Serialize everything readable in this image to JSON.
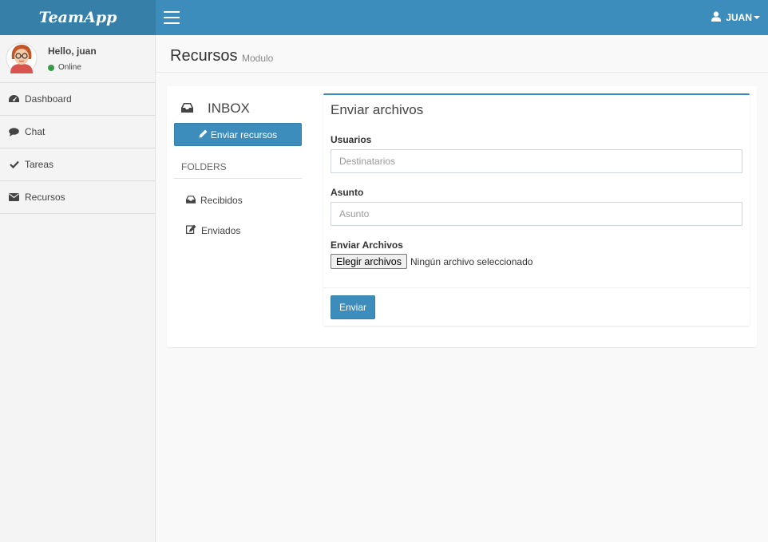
{
  "app": {
    "brand": "TeamApp"
  },
  "header": {
    "user_label": "JUAN"
  },
  "sidebar": {
    "greeting": "Hello, juan",
    "status": "Online",
    "items": [
      {
        "label": "Dashboard",
        "icon": "dashboard-icon"
      },
      {
        "label": "Chat",
        "icon": "chat-icon"
      },
      {
        "label": "Tareas",
        "icon": "check-icon"
      },
      {
        "label": "Recursos",
        "icon": "envelope-icon"
      }
    ]
  },
  "page": {
    "title": "Recursos",
    "subtitle": "Modulo"
  },
  "mailbox": {
    "title": "INBOX",
    "compose_label": "Enviar recursos",
    "folders_label": "FOLDERS",
    "folders": [
      {
        "label": "Recibidos",
        "icon": "inbox-icon"
      },
      {
        "label": "Enviados",
        "icon": "edit-icon"
      }
    ]
  },
  "form": {
    "title": "Enviar archivos",
    "users_label": "Usuarios",
    "users_placeholder": "Destinatarios",
    "subject_label": "Asunto",
    "subject_placeholder": "Asunto",
    "files_label": "Enviar Archivos",
    "file_button": "Elegir archivos",
    "file_status": "Ningún archivo seleccionado",
    "submit_label": "Enviar"
  },
  "colors": {
    "primary": "#3c8dbc",
    "brand_bg": "#367fa9",
    "online": "#3d9a48"
  }
}
